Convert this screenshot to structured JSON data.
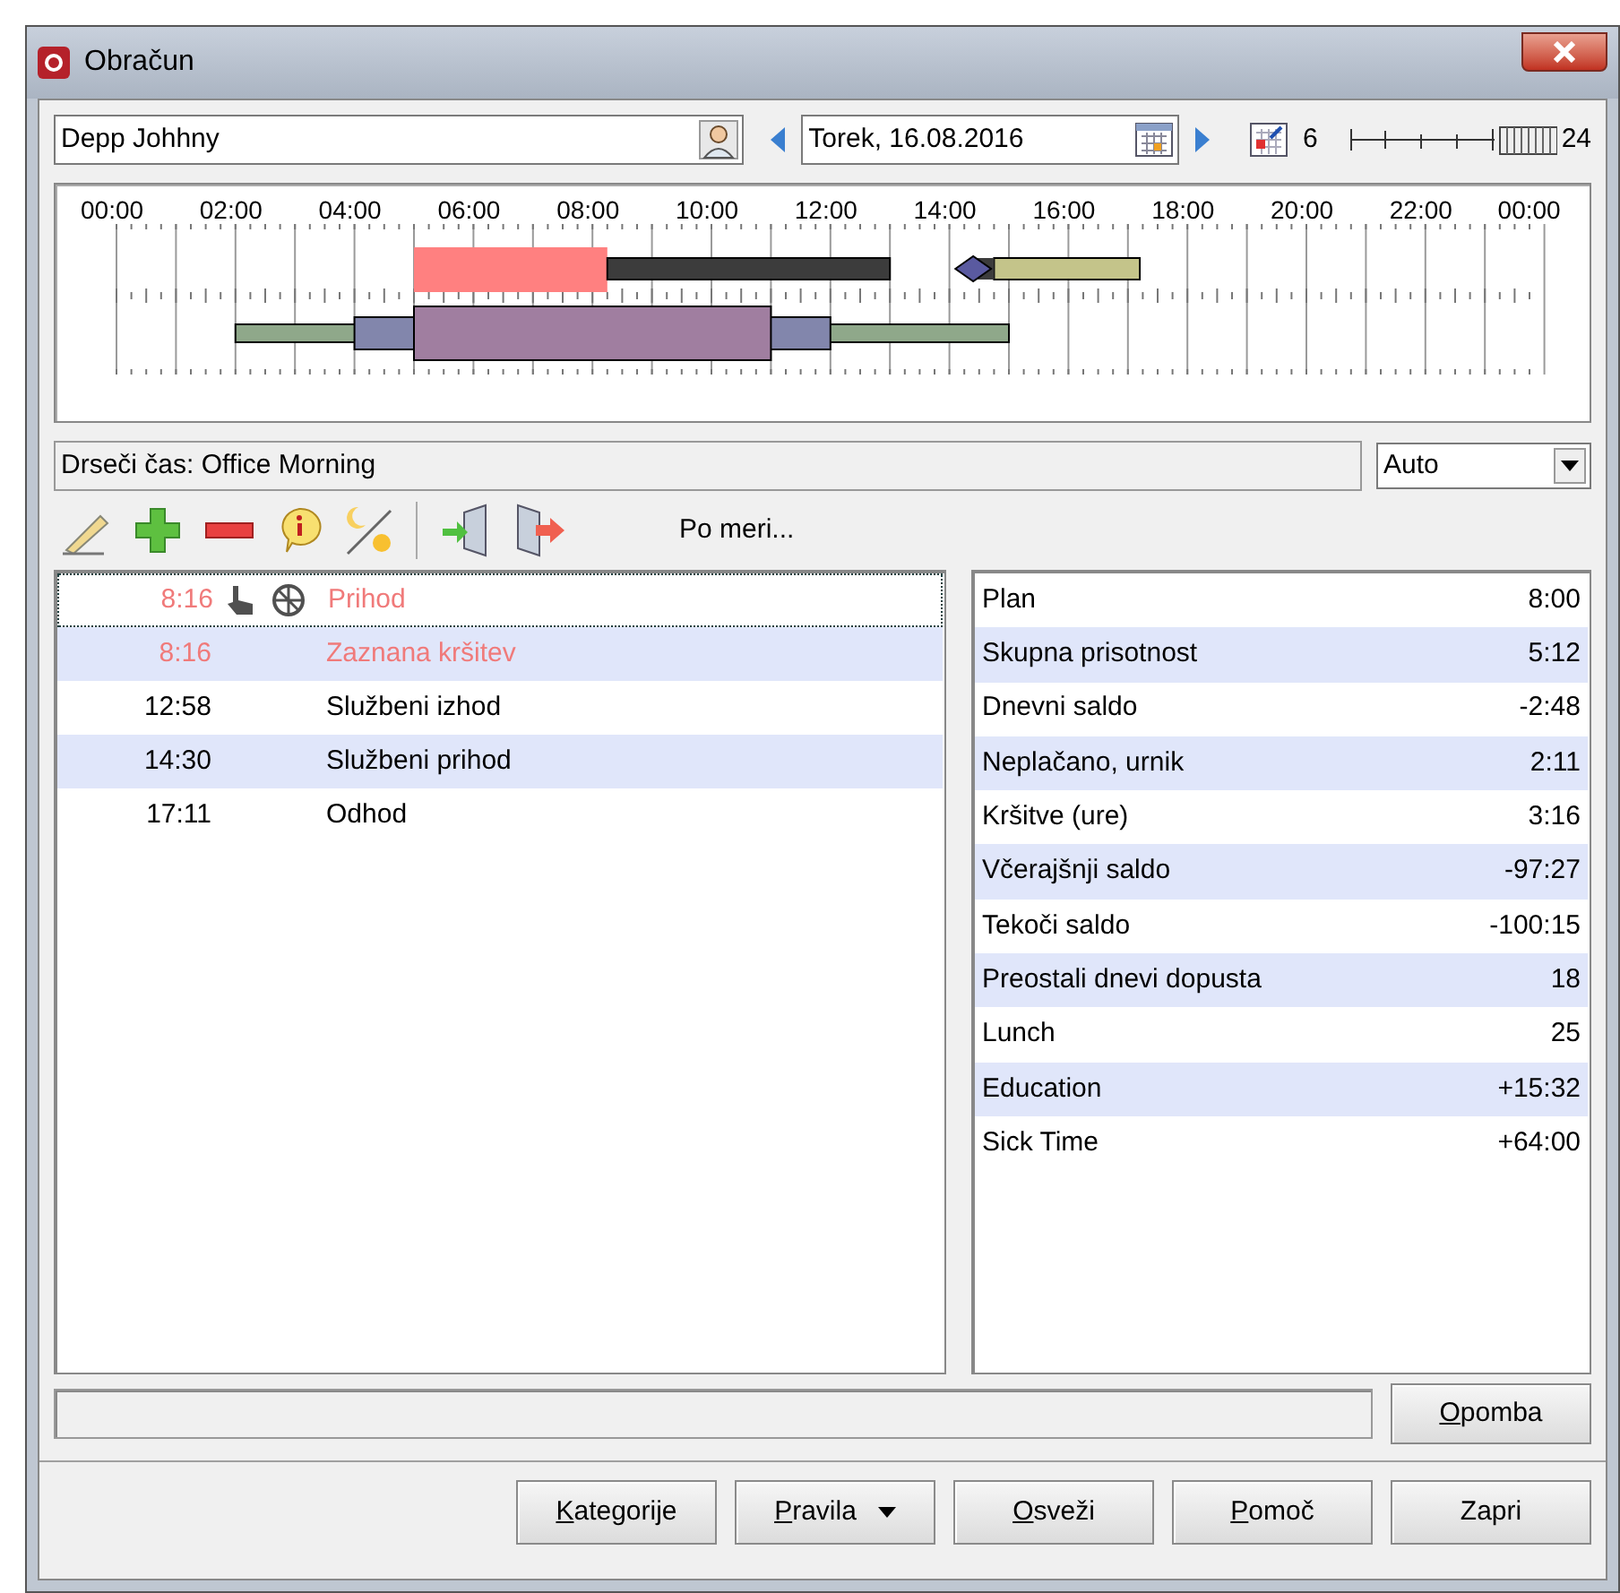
{
  "window": {
    "title": "Obračun"
  },
  "employee": {
    "value": "Depp Johhny"
  },
  "date": {
    "value": "Torek, 16.08.2016"
  },
  "range": {
    "start": "6",
    "end": "24"
  },
  "timeline": {
    "hours": [
      "00:00",
      "02:00",
      "04:00",
      "06:00",
      "08:00",
      "10:00",
      "12:00",
      "14:00",
      "16:00",
      "18:00",
      "20:00",
      "22:00",
      "00:00"
    ]
  },
  "schedule": {
    "value": "Drseči čas: Office Morning"
  },
  "mode": {
    "value": "Auto"
  },
  "toolbar": {
    "custom_label": "Po meri..."
  },
  "events": [
    {
      "time": "8:16",
      "label": "Prihod",
      "violation": true,
      "selected": true,
      "icons": true
    },
    {
      "time": "8:16",
      "label": "Zaznana kršitev",
      "violation": true,
      "selected": false,
      "icons": false
    },
    {
      "time": "12:58",
      "label": "Službeni izhod",
      "violation": false,
      "selected": false,
      "icons": false
    },
    {
      "time": "14:30",
      "label": "Službeni prihod",
      "violation": false,
      "selected": false,
      "icons": false
    },
    {
      "time": "17:11",
      "label": "Odhod",
      "violation": false,
      "selected": false,
      "icons": false
    }
  ],
  "summary": [
    {
      "label": "Plan",
      "value": "8:00"
    },
    {
      "label": "Skupna prisotnost",
      "value": "5:12"
    },
    {
      "label": "Dnevni saldo",
      "value": "-2:48"
    },
    {
      "label": "Neplačano, urnik",
      "value": "2:11"
    },
    {
      "label": "Kršitve (ure)",
      "value": "3:16"
    },
    {
      "label": "Včerajšnji saldo",
      "value": "-97:27"
    },
    {
      "label": "Tekoči saldo",
      "value": "-100:15"
    },
    {
      "label": "Preostali dnevi dopusta",
      "value": "18"
    },
    {
      "label": "Lunch",
      "value": "25"
    },
    {
      "label": "Education",
      "value": "+15:32"
    },
    {
      "label": "Sick Time",
      "value": "+64:00"
    }
  ],
  "note_button": {
    "mnemonic": "O",
    "rest": "pomba"
  },
  "buttons": [
    {
      "mnemonic": "K",
      "rest": "ategorije",
      "kind": "plain"
    },
    {
      "mnemonic": "P",
      "rest": "ravila",
      "kind": "dropdown"
    },
    {
      "mnemonic": "O",
      "rest": "sveži",
      "kind": "plain"
    },
    {
      "mnemonic": "P",
      "rest": "omoč",
      "kind": "plain"
    },
    {
      "rest": "Zapri",
      "kind": "plain"
    }
  ]
}
